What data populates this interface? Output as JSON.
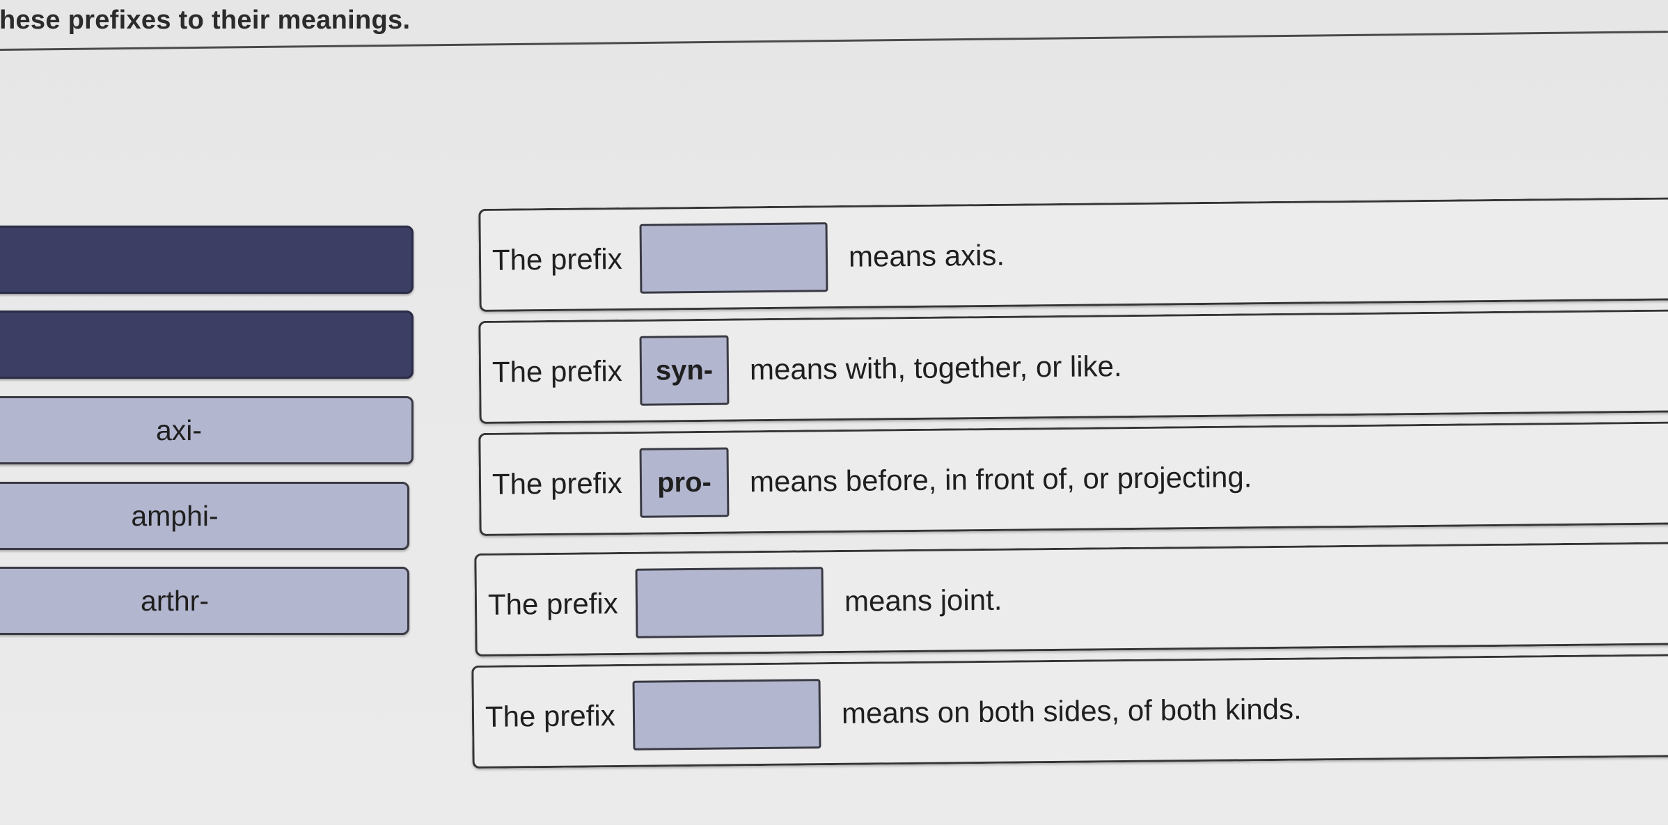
{
  "instruction": "these prefixes to their meanings.",
  "answer_bank": {
    "filled_slots": [
      {
        "state": "used"
      },
      {
        "state": "used"
      }
    ],
    "options": [
      {
        "label": "axi-"
      },
      {
        "label": "amphi-"
      },
      {
        "label": "arthr-"
      }
    ]
  },
  "rows": [
    {
      "prefix_label": "The prefix",
      "answer": "",
      "meaning": "means axis."
    },
    {
      "prefix_label": "The prefix",
      "answer": "syn-",
      "meaning": "means with, together, or like."
    },
    {
      "prefix_label": "The prefix",
      "answer": "pro-",
      "meaning": "means before, in front of, or projecting."
    },
    {
      "prefix_label": "The prefix",
      "answer": "",
      "meaning": "means joint."
    },
    {
      "prefix_label": "The prefix",
      "answer": "",
      "meaning": "means on both sides, of both kinds."
    }
  ],
  "colors": {
    "filled_tile": "#3c3f63",
    "option_tile": "#b3b6cf",
    "background": "#e8e8e8"
  }
}
